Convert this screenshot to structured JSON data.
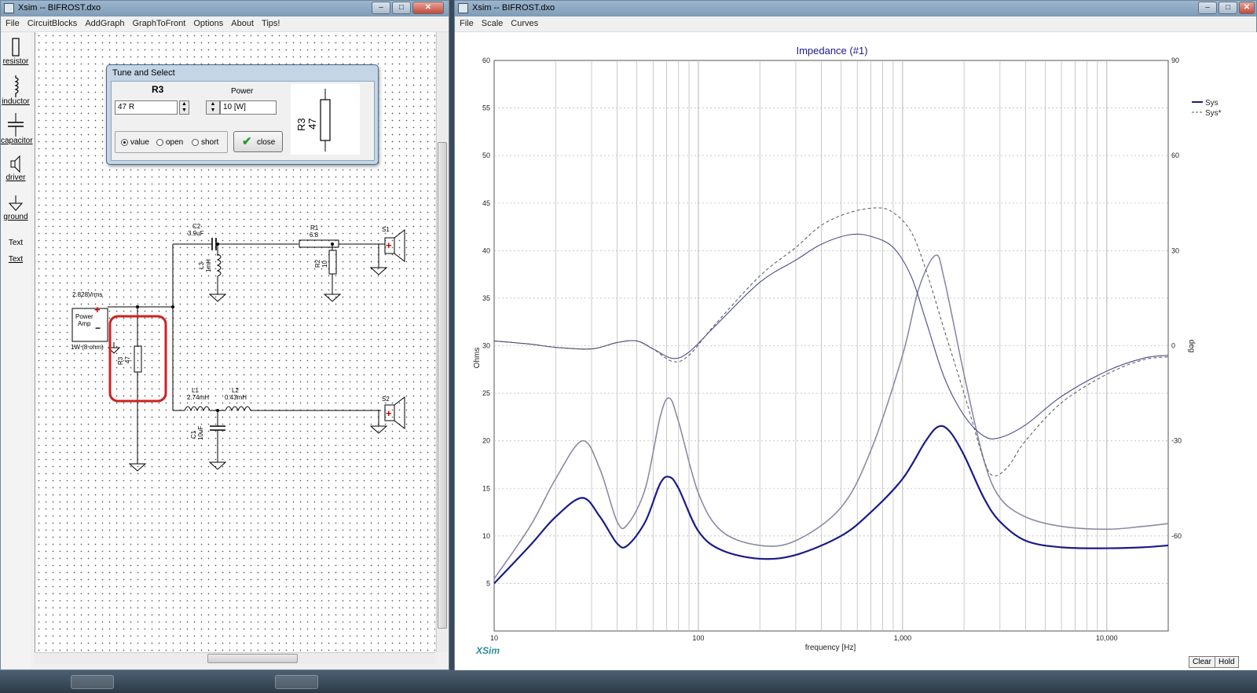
{
  "left_window": {
    "title": "Xsim -- BIFROST.dxo",
    "menu": [
      "File",
      "CircuitBlocks",
      "AddGraph",
      "GraphToFront",
      "Options",
      "About",
      "Tips!"
    ],
    "toolbox": [
      "resistor",
      "inductor",
      "capacitor",
      "driver",
      "ground",
      "Text",
      "Text"
    ]
  },
  "tune_dialog": {
    "title": "Tune and Select",
    "component": "R3",
    "value_field": "47 R",
    "power_label": "Power",
    "power_field": "10 [W]",
    "radios": [
      "value",
      "open",
      "short"
    ],
    "selected_radio": "value",
    "close_label": "close",
    "preview_name": "R3",
    "preview_value": "47"
  },
  "schematic": {
    "source": {
      "voltage": "2.828Vrms",
      "line1": "Power",
      "line2": "Amp",
      "note": "1W (8 ohm)"
    },
    "C2": {
      "name": "C2",
      "value": "3.9uF"
    },
    "L3": {
      "name": "L3",
      "value": "1mH"
    },
    "R1": {
      "name": "R1",
      "value": "6.8"
    },
    "R2": {
      "name": "R2",
      "value": "10"
    },
    "R3": {
      "name": "R3",
      "value": "47"
    },
    "L1": {
      "name": "L1",
      "value": "2.74mH"
    },
    "L2": {
      "name": "L2",
      "value": "0.43mH"
    },
    "C1": {
      "name": "C1",
      "value": "10uF"
    },
    "S1": "S1",
    "S2": "S2",
    "plus": "+",
    "minus": "−"
  },
  "right_window": {
    "title": "Xsim -- BIFROST.dxo",
    "menu": [
      "File",
      "Scale",
      "Curves"
    ],
    "clear_label": "Clear",
    "hold_label": "Hold",
    "logo": "XSim"
  },
  "chart_data": {
    "type": "line",
    "title": "Impedance (#1)",
    "xlabel": "frequency [Hz]",
    "ylabel": "Ohms",
    "y2label": "deg",
    "x_scale": "log",
    "xlim": [
      10,
      20000
    ],
    "ylim": [
      0,
      60
    ],
    "y2lim": [
      -90,
      90
    ],
    "xticks": [
      10,
      100,
      1000,
      10000
    ],
    "xtick_labels": [
      "10",
      "100",
      "1,000",
      "10,000"
    ],
    "yticks": [
      5,
      10,
      15,
      20,
      25,
      30,
      35,
      40,
      45,
      50,
      55,
      60
    ],
    "y2ticks": [
      -60,
      -30,
      0,
      30,
      60,
      90
    ],
    "grid": true,
    "legend_position": "top-right",
    "legend": [
      {
        "name": "Sys",
        "style": "solid",
        "color": "#1a1a8c"
      },
      {
        "name": "Sys*",
        "style": "dashed",
        "color": "#555555"
      }
    ],
    "series": [
      {
        "name": "Sys",
        "axis": "left",
        "style": "solid",
        "color": "#1a1a8c",
        "width": 2.2,
        "points": [
          [
            10,
            5
          ],
          [
            15,
            9
          ],
          [
            20,
            12
          ],
          [
            27,
            14
          ],
          [
            33,
            12
          ],
          [
            40,
            9.2
          ],
          [
            45,
            9
          ],
          [
            55,
            11.5
          ],
          [
            65,
            15.5
          ],
          [
            72,
            16.2
          ],
          [
            80,
            15
          ],
          [
            100,
            10.5
          ],
          [
            130,
            8.5
          ],
          [
            200,
            7.6
          ],
          [
            300,
            8
          ],
          [
            500,
            10
          ],
          [
            700,
            12.5
          ],
          [
            1000,
            16
          ],
          [
            1300,
            20
          ],
          [
            1500,
            21.5
          ],
          [
            1700,
            21
          ],
          [
            2000,
            18.5
          ],
          [
            2500,
            14
          ],
          [
            3000,
            11.5
          ],
          [
            4000,
            9.5
          ],
          [
            6000,
            8.8
          ],
          [
            10000,
            8.7
          ],
          [
            15000,
            8.8
          ],
          [
            20000,
            9
          ]
        ]
      },
      {
        "name": "Sys*",
        "axis": "left",
        "style": "solid",
        "color": "#8a8aa5",
        "width": 1.6,
        "points": [
          [
            10,
            5.5
          ],
          [
            15,
            11
          ],
          [
            20,
            16
          ],
          [
            27,
            20
          ],
          [
            33,
            17
          ],
          [
            40,
            11.5
          ],
          [
            45,
            11.2
          ],
          [
            55,
            15
          ],
          [
            65,
            22.5
          ],
          [
            72,
            24.5
          ],
          [
            80,
            22
          ],
          [
            100,
            14.5
          ],
          [
            130,
            10.5
          ],
          [
            200,
            9
          ],
          [
            300,
            9.5
          ],
          [
            500,
            13
          ],
          [
            700,
            19
          ],
          [
            1000,
            29
          ],
          [
            1200,
            36
          ],
          [
            1450,
            39.5
          ],
          [
            1600,
            37
          ],
          [
            2000,
            27
          ],
          [
            2500,
            18
          ],
          [
            3000,
            14
          ],
          [
            4000,
            12
          ],
          [
            6000,
            11
          ],
          [
            10000,
            10.7
          ],
          [
            15000,
            11
          ],
          [
            20000,
            11.3
          ]
        ]
      },
      {
        "name": "Sys",
        "axis": "right",
        "style": "solid",
        "color": "#4a4a8c",
        "width": 1.1,
        "points": [
          [
            10,
            1.5
          ],
          [
            15,
            0.5
          ],
          [
            20,
            -0.5
          ],
          [
            30,
            -1
          ],
          [
            40,
            1
          ],
          [
            50,
            1.5
          ],
          [
            60,
            -1
          ],
          [
            75,
            -4
          ],
          [
            90,
            -2
          ],
          [
            120,
            6
          ],
          [
            200,
            20
          ],
          [
            300,
            27
          ],
          [
            400,
            32
          ],
          [
            550,
            35
          ],
          [
            700,
            34.5
          ],
          [
            900,
            31
          ],
          [
            1100,
            22
          ],
          [
            1300,
            8
          ],
          [
            1600,
            -10
          ],
          [
            2000,
            -22
          ],
          [
            2500,
            -28.5
          ],
          [
            3000,
            -29
          ],
          [
            4000,
            -25
          ],
          [
            6000,
            -16
          ],
          [
            10000,
            -8
          ],
          [
            15000,
            -4
          ],
          [
            20000,
            -3
          ]
        ]
      },
      {
        "name": "Sys*",
        "axis": "right",
        "style": "dashed",
        "color": "#555555",
        "width": 1.0,
        "points": [
          [
            10,
            1.5
          ],
          [
            15,
            0.5
          ],
          [
            20,
            -0.5
          ],
          [
            30,
            -1
          ],
          [
            40,
            1
          ],
          [
            50,
            1.5
          ],
          [
            60,
            -1
          ],
          [
            75,
            -5
          ],
          [
            90,
            -3
          ],
          [
            120,
            6.5
          ],
          [
            200,
            22
          ],
          [
            300,
            31
          ],
          [
            400,
            38
          ],
          [
            550,
            42
          ],
          [
            750,
            43.5
          ],
          [
            900,
            42
          ],
          [
            1100,
            36
          ],
          [
            1300,
            24
          ],
          [
            1600,
            5
          ],
          [
            2000,
            -15
          ],
          [
            2500,
            -36
          ],
          [
            2800,
            -41
          ],
          [
            3300,
            -38
          ],
          [
            4000,
            -30
          ],
          [
            6000,
            -18
          ],
          [
            10000,
            -9
          ],
          [
            15000,
            -4.5
          ],
          [
            20000,
            -3.5
          ]
        ]
      }
    ]
  }
}
